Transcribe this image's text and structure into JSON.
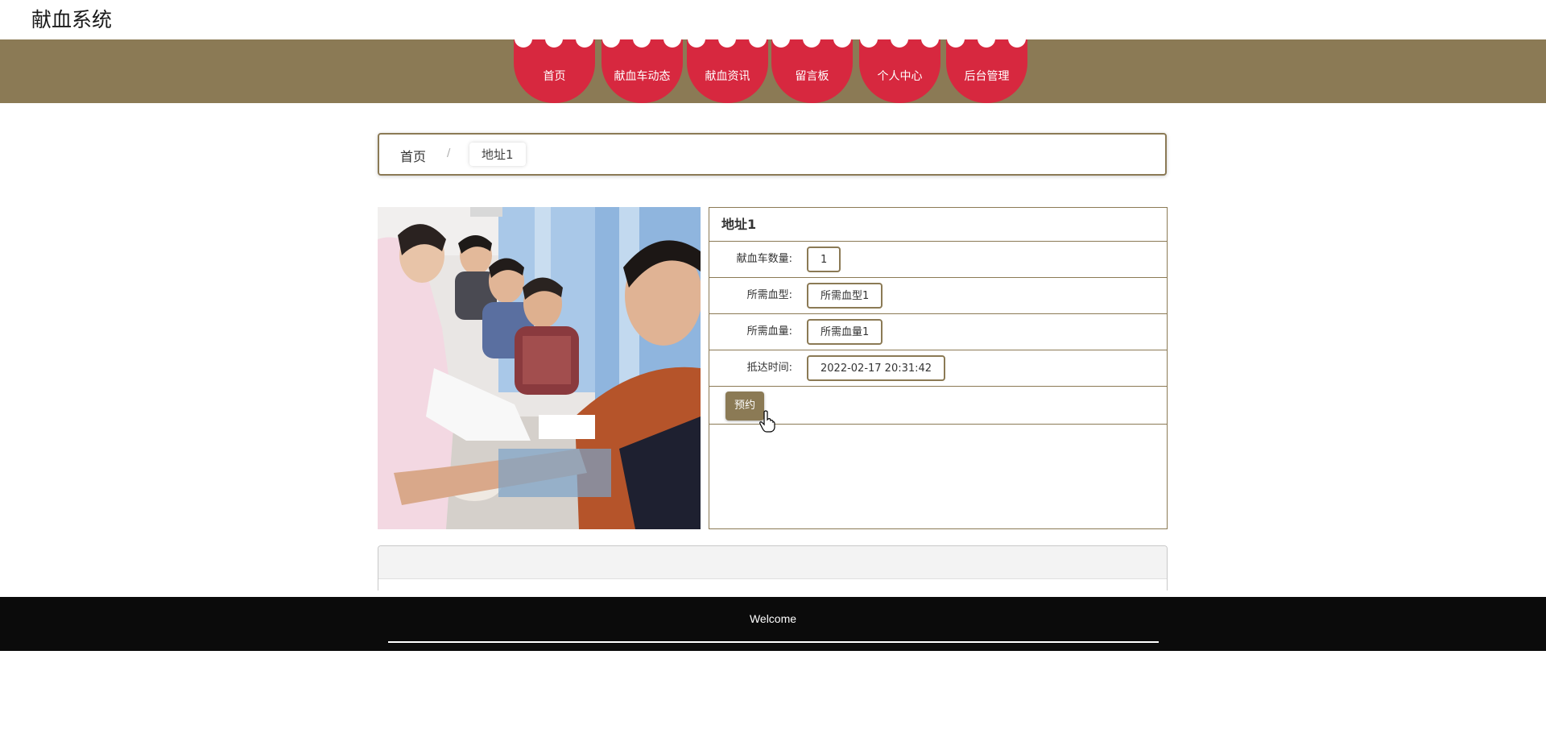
{
  "app": {
    "title": "献血系统"
  },
  "nav": {
    "items": [
      {
        "label": "首页"
      },
      {
        "label": "献血车动态"
      },
      {
        "label": "献血资讯"
      },
      {
        "label": "留言板"
      },
      {
        "label": "个人中心"
      },
      {
        "label": "后台管理"
      }
    ]
  },
  "breadcrumb": {
    "home": "首页",
    "separator": "/",
    "current": "地址1"
  },
  "detail": {
    "title": "地址1",
    "fields": [
      {
        "label": "献血车数量:",
        "value": "1"
      },
      {
        "label": "所需血型:",
        "value": "所需血型1"
      },
      {
        "label": "所需血量:",
        "value": "所需血量1"
      },
      {
        "label": "抵达时间:",
        "value": "2022-02-17 20:31:42"
      }
    ],
    "reserve_button": "预约"
  },
  "footer": {
    "text": "Welcome"
  },
  "colors": {
    "brand": "#8b7a55",
    "nav_red": "#d7283f",
    "footer_bg": "#0b0b0b"
  }
}
